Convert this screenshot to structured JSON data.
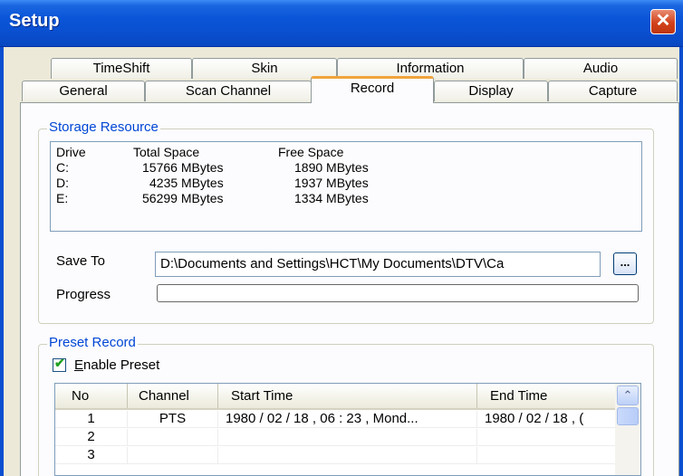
{
  "window": {
    "title": "Setup",
    "close_glyph": "✕"
  },
  "tabs_row1": [
    {
      "label": "TimeShift"
    },
    {
      "label": "Skin"
    },
    {
      "label": "Information"
    },
    {
      "label": "Audio"
    }
  ],
  "tabs_row2": [
    {
      "label": "General"
    },
    {
      "label": "Scan Channel"
    },
    {
      "label": "Record"
    },
    {
      "label": "Display"
    },
    {
      "label": "Capture"
    }
  ],
  "storage": {
    "group_label": "Storage Resource",
    "headers": [
      "Drive",
      "Total Space",
      "Free Space"
    ],
    "rows": [
      {
        "drive": "C:",
        "total": "15766 MBytes",
        "free": "1890 MBytes"
      },
      {
        "drive": "D:",
        "total": "4235 MBytes",
        "free": "1937 MBytes"
      },
      {
        "drive": "E:",
        "total": "56299 MBytes",
        "free": "1334 MBytes"
      }
    ],
    "save_to_label": "Save To",
    "save_to_value": "D:\\Documents and Settings\\HCT\\My Documents\\DTV\\Ca",
    "browse_label": "...",
    "progress_label": "Progress",
    "progress_value": 0
  },
  "preset": {
    "group_label": "Preset Record",
    "enable_label_underlined": "E",
    "enable_label_rest": "nable Preset",
    "enable_checked": true,
    "columns": [
      "No",
      "Channel",
      "Start Time",
      "End Time"
    ],
    "rows": [
      {
        "no": "1",
        "channel": "PTS",
        "start": "1980 / 02 / 18 , 06 : 23 , Mond...",
        "end": "1980 / 02 / 18 , ("
      },
      {
        "no": "2",
        "channel": "",
        "start": "",
        "end": ""
      },
      {
        "no": "3",
        "channel": "",
        "start": "",
        "end": ""
      }
    ],
    "scroll_up_glyph": "⌃"
  },
  "colors": {
    "title_bar": "#0A55D8",
    "group_label": "#0046D5",
    "active_tab_accent": "#F0A43C",
    "close_button": "#D2421C"
  },
  "icons": {
    "close": "close-icon",
    "check": "checkmark-icon",
    "scroll_up": "chevron-up-icon"
  }
}
